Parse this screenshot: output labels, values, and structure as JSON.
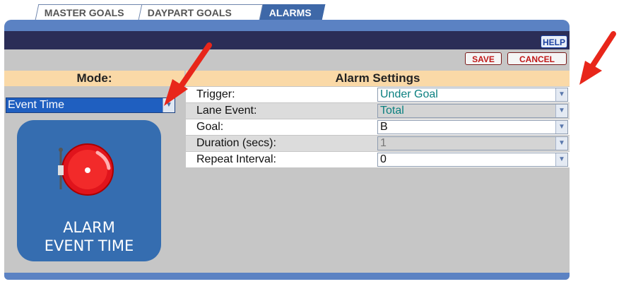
{
  "tabs": [
    {
      "label": "MASTER GOALS"
    },
    {
      "label": "DAYPART GOALS"
    },
    {
      "label": "ALARMS",
      "active": true
    }
  ],
  "toolbar": {
    "help_label": "HELP",
    "save_label": "SAVE",
    "cancel_label": "CANCEL"
  },
  "mode": {
    "header": "Mode:",
    "selected": "Event Time",
    "icon_text_line1": "ALARM",
    "icon_text_line2": "EVENT TIME"
  },
  "alarm_settings": {
    "header": "Alarm Settings",
    "rows": [
      {
        "label": "Trigger:",
        "value": "Under Goal"
      },
      {
        "label": "Lane Event:",
        "value": "Total"
      },
      {
        "label": "Goal:",
        "value": "B"
      },
      {
        "label": "Duration (secs):",
        "value": "1"
      },
      {
        "label": "Repeat Interval:",
        "value": "0"
      }
    ]
  },
  "colors": {
    "accent": "#5b82c3",
    "navbar": "#2b2d57",
    "header": "#fad9a7",
    "arrow": "#e8261a"
  }
}
